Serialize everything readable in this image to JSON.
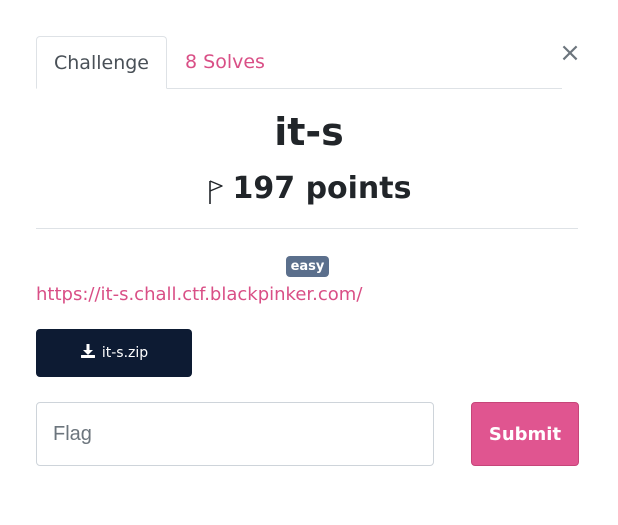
{
  "tabs": [
    {
      "label": "Challenge",
      "active": true
    },
    {
      "label": "8 Solves",
      "active": false
    }
  ],
  "close_symbol": "×",
  "challenge": {
    "name": "it-s",
    "points": "197 points",
    "tag": "easy",
    "link": "https://it-s.chall.ctf.blackpinker.com/",
    "file": "it-s.zip"
  },
  "form": {
    "flag_placeholder": "Flag",
    "flag_value": "",
    "submit_label": "Submit"
  },
  "icons": {
    "close": "close-icon",
    "points": "flag-icon",
    "download": "download-icon"
  },
  "colors": {
    "accent_pink": "#d94f86",
    "submit_bg": "#e05590",
    "download_bg": "#0d1b33",
    "badge_bg": "#5b6f8c"
  }
}
